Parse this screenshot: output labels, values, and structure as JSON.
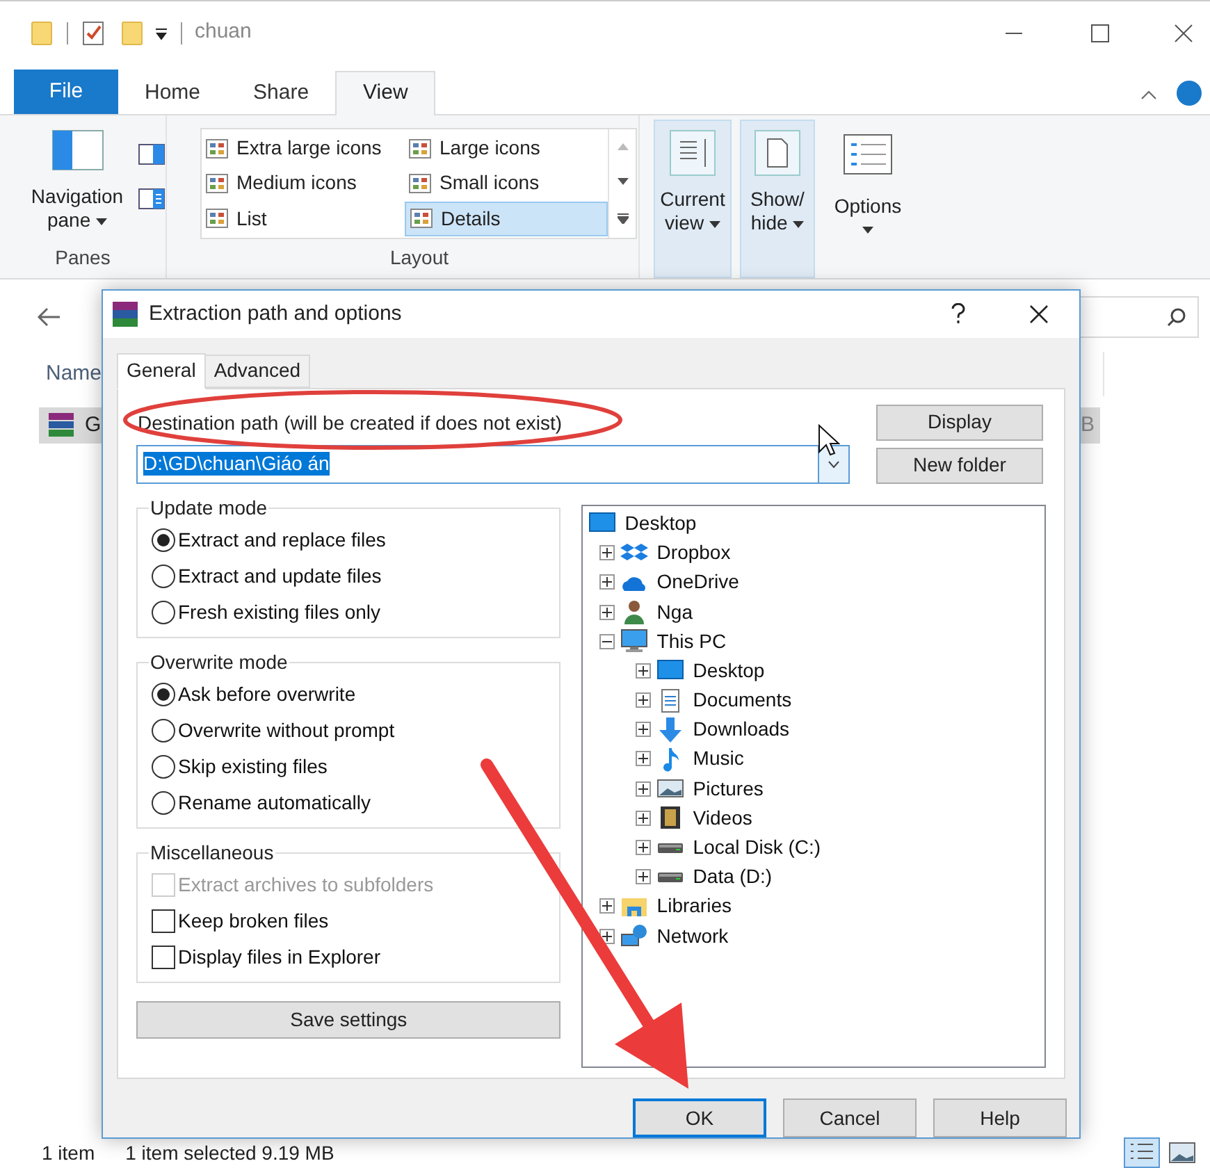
{
  "explorer": {
    "title": "chuan",
    "ribbon_tabs": [
      {
        "label": "File",
        "kind": "file",
        "selected": false
      },
      {
        "label": "Home",
        "kind": "tab",
        "selected": false
      },
      {
        "label": "Share",
        "kind": "tab",
        "selected": false
      },
      {
        "label": "View",
        "kind": "tab",
        "selected": true
      }
    ],
    "panes": {
      "navigation_pane": "Navigation pane",
      "group_label": "Panes"
    },
    "layout": {
      "items": [
        {
          "label": "Extra large icons",
          "selected": false
        },
        {
          "label": "Large icons",
          "selected": false
        },
        {
          "label": "Medium icons",
          "selected": false
        },
        {
          "label": "Small icons",
          "selected": false
        },
        {
          "label": "List",
          "selected": false
        },
        {
          "label": "Details",
          "selected": true
        }
      ],
      "group_label": "Layout"
    },
    "current_view": "Current view",
    "show_hide": "Show/ hide",
    "options": "Options",
    "column_header": "Name",
    "file_row": {
      "name": "G",
      "column_2": "B"
    },
    "status_bar": {
      "items": "1 item",
      "selection": "1 item selected 9.19 MB"
    }
  },
  "dialog": {
    "title": "Extraction path and options",
    "tabs": [
      {
        "label": "General",
        "selected": true
      },
      {
        "label": "Advanced",
        "selected": false
      }
    ],
    "destination_label": "Destination path (will be created if does not exist)",
    "destination_value": "D:\\GD\\chuan\\Giáo án",
    "side_buttons": [
      "Display",
      "New folder"
    ],
    "update_mode": {
      "label": "Update mode",
      "options": [
        {
          "label": "Extract and replace files",
          "selected": true
        },
        {
          "label": "Extract and update files",
          "selected": false
        },
        {
          "label": "Fresh existing files only",
          "selected": false
        }
      ]
    },
    "overwrite_mode": {
      "label": "Overwrite mode",
      "options": [
        {
          "label": "Ask before overwrite",
          "selected": true
        },
        {
          "label": "Overwrite without prompt",
          "selected": false
        },
        {
          "label": "Skip existing files",
          "selected": false
        },
        {
          "label": "Rename automatically",
          "selected": false
        }
      ]
    },
    "miscellaneous": {
      "label": "Miscellaneous",
      "options": [
        {
          "label": "Extract archives to subfolders",
          "checked": false,
          "disabled": true
        },
        {
          "label": "Keep broken files",
          "checked": false,
          "disabled": false
        },
        {
          "label": "Display files in Explorer",
          "checked": false,
          "disabled": false
        }
      ]
    },
    "save_button": "Save settings",
    "tree": [
      {
        "label": "Desktop",
        "kind": "desktop",
        "children": [
          {
            "label": "Dropbox",
            "kind": "box",
            "expanded": false
          },
          {
            "label": "OneDrive",
            "kind": "cloud",
            "expanded": false
          },
          {
            "label": "Nga",
            "kind": "user",
            "expanded": false
          },
          {
            "label": "This PC",
            "kind": "computer",
            "expanded": true,
            "children": [
              {
                "label": "Desktop",
                "kind": "desktop",
                "expanded": false
              },
              {
                "label": "Documents",
                "kind": "document",
                "expanded": false
              },
              {
                "label": "Downloads",
                "kind": "download",
                "expanded": false
              },
              {
                "label": "Music",
                "kind": "music",
                "expanded": false
              },
              {
                "label": "Pictures",
                "kind": "image",
                "expanded": false
              },
              {
                "label": "Videos",
                "kind": "film",
                "expanded": false
              },
              {
                "label": "Local Disk (C:)",
                "kind": "drive",
                "expanded": false
              },
              {
                "label": "Data (D:)",
                "kind": "drive",
                "expanded": false
              }
            ]
          },
          {
            "label": "Libraries",
            "kind": "library",
            "expanded": false
          },
          {
            "label": "Network",
            "kind": "network",
            "expanded": false
          }
        ]
      }
    ],
    "buttons": [
      {
        "label": "OK",
        "default": true
      },
      {
        "label": "Cancel",
        "default": false
      },
      {
        "label": "Help",
        "default": false
      }
    ]
  }
}
